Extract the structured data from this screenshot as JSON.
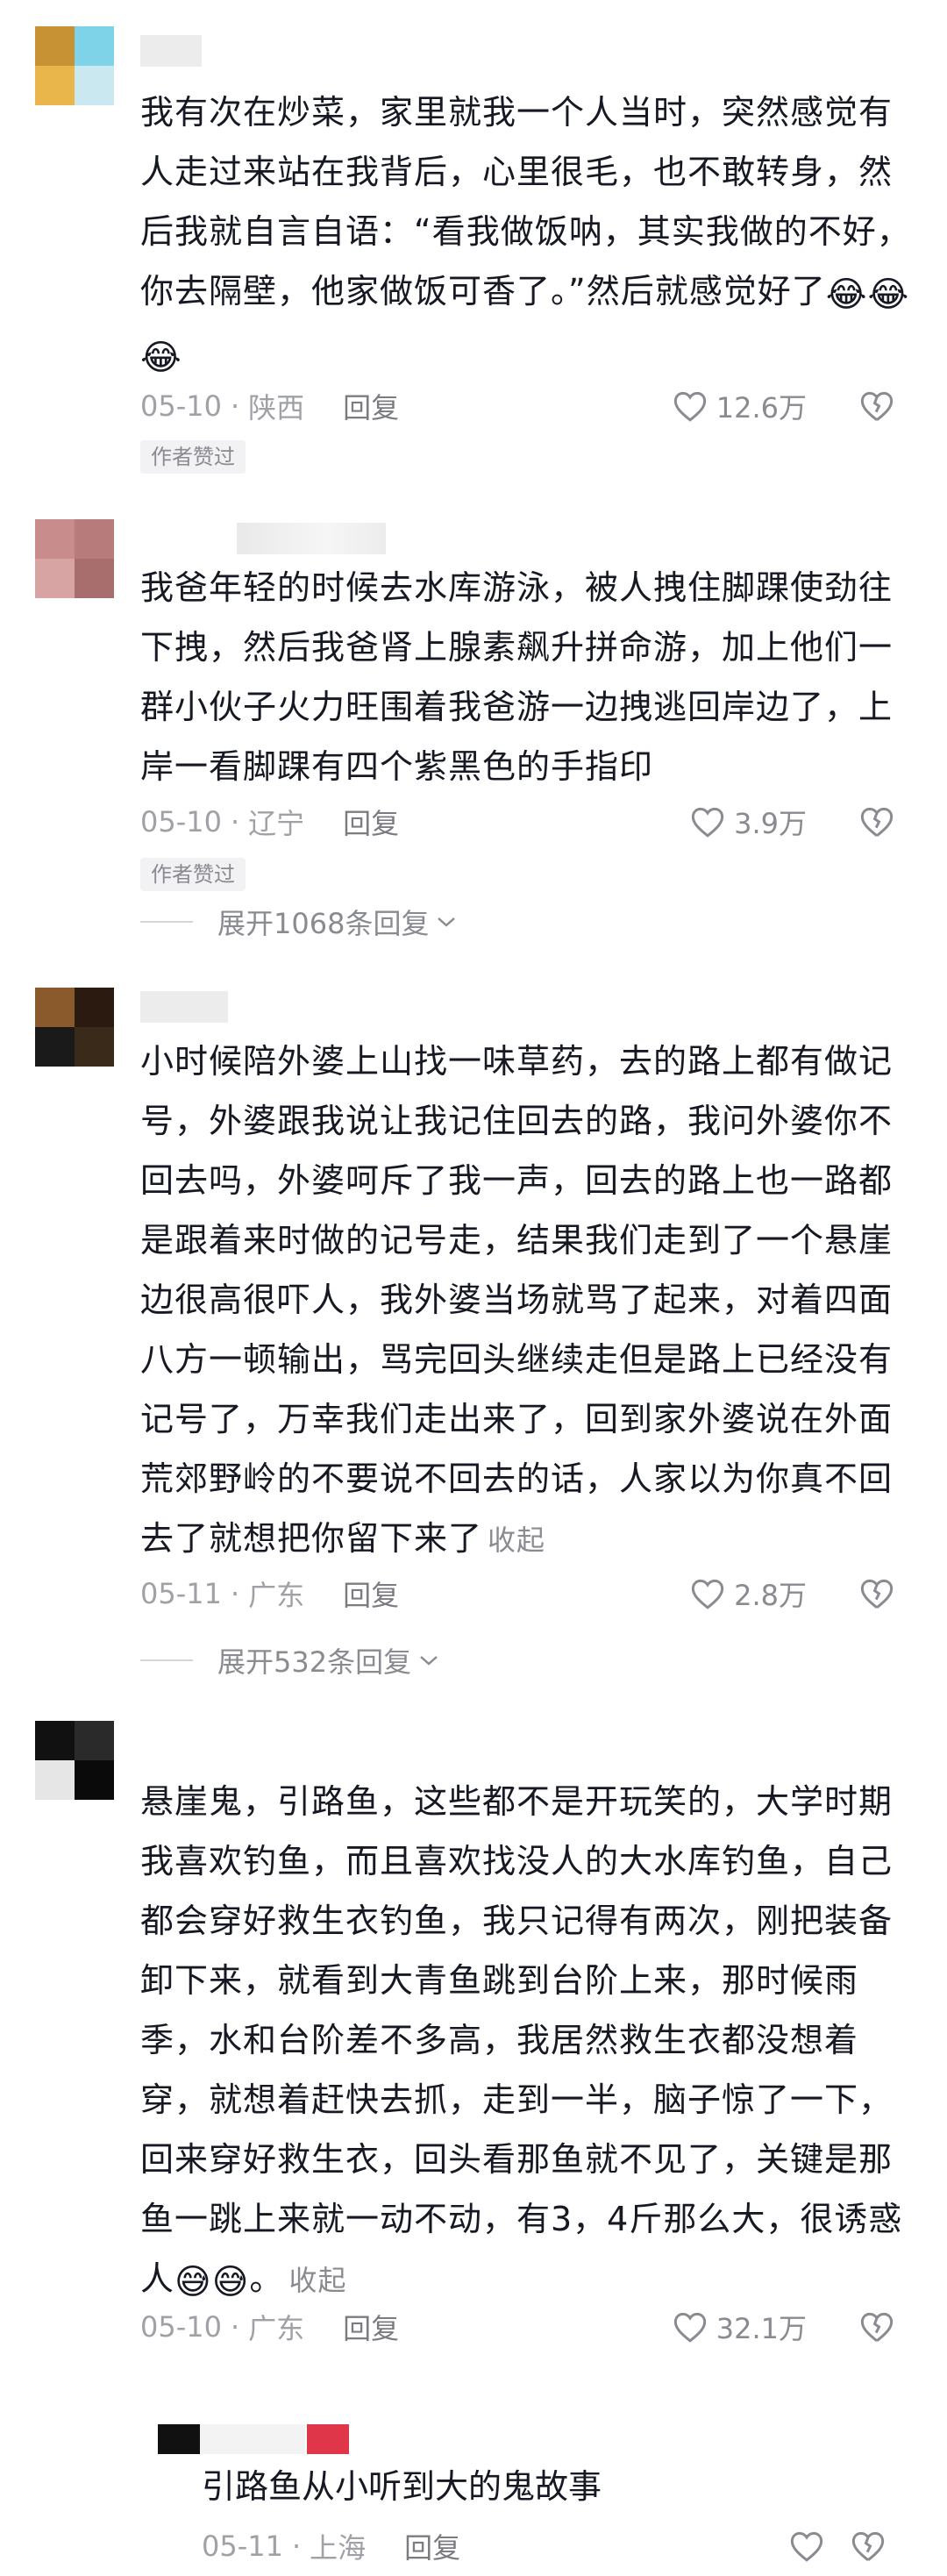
{
  "comments": [
    {
      "avatar_colors": [
        "#c79233",
        "#7fd3e8",
        "#e8b64b",
        "#c9e8f0"
      ],
      "text": "我有次在炒菜，家里就我一个人当时，突然感觉有人走过来站在我背后，心里很毛，也不敢转身，然后我就自言自语：“看我做饭呐，其实我做的不好，你去隔壁，他家做饭可香了。”然后就感觉好了",
      "emoji": [
        "😂",
        "😂",
        "😂"
      ],
      "date": "05-10",
      "region": "陕西",
      "reply": "回复",
      "likes": "12.6万",
      "tag": "作者赞过"
    },
    {
      "avatar_colors": [
        "#c98c8c",
        "#b87b7b",
        "#d7a3a3",
        "#a86d6d"
      ],
      "text": "我爸年轻的时候去水库游泳，被人拽住脚踝使劲往下拽，然后我爸肾上腺素飙升拼命游，加上他们一群小伙子火力旺围着我爸游一边拽逃回岸边了，上岸一看脚踝有四个紫黑色的手指印",
      "date": "05-10",
      "region": "辽宁",
      "reply": "回复",
      "likes": "3.9万",
      "tag": "作者赞过",
      "expand": "展开1068条回复"
    },
    {
      "avatar_colors": [
        "#8a5a2c",
        "#2a1a10",
        "#1a1a1a",
        "#3a2a1a"
      ],
      "text": "小时候陪外婆上山找一味草药，去的路上都有做记号，外婆跟我说让我记住回去的路，我问外婆你不回去吗，外婆呵斥了我一声，回去的路上也一路都是跟着来时做的记号走，结果我们走到了一个悬崖边很高很吓人，我外婆当场就骂了起来，对着四面八方一顿输出，骂完回头继续走但是路上已经没有记号了，万幸我们走出来了，回到家外婆说在外面荒郊野岭的不要说不回去的话，人家以为你真不回去了就想把你留下来了",
      "collapse": "收起",
      "date": "05-11",
      "region": "广东",
      "reply": "回复",
      "likes": "2.8万",
      "expand": "展开532条回复"
    },
    {
      "avatar_colors": [
        "#111111",
        "#2a2a2a",
        "#e6e6e6",
        "#0a0a0a"
      ],
      "text": "悬崖鬼，引路鱼，这些都不是开玩笑的，大学时期我喜欢钓鱼，而且喜欢找没人的大水库钓鱼，自己都会穿好救生衣钓鱼，我只记得有两次，刚把装备卸下来，就看到大青鱼跳到台阶上来，那时候雨季，水和台阶差不多高，我居然救生衣都没想着穿，就想着赶快去抓，走到一半，脑子惊了一下，回来穿好救生衣，回头看那鱼就不见了，关键是那鱼一跳上来就一动不动，有3，4斤那么大，很诱惑人",
      "emoji": [
        "😅",
        "😅"
      ],
      "tail": "。",
      "collapse": "收起",
      "date": "05-10",
      "region": "广东",
      "reply": "回复",
      "likes": "32.1万"
    }
  ],
  "sub_reply": {
    "text": "引路鱼从小听到大的鬼故事",
    "date": "05-11",
    "region": "上海",
    "reply": "回复"
  },
  "colors": {
    "text": "#161823",
    "meta": "#a0a1a6",
    "tag_bg": "#f2f2f4"
  }
}
